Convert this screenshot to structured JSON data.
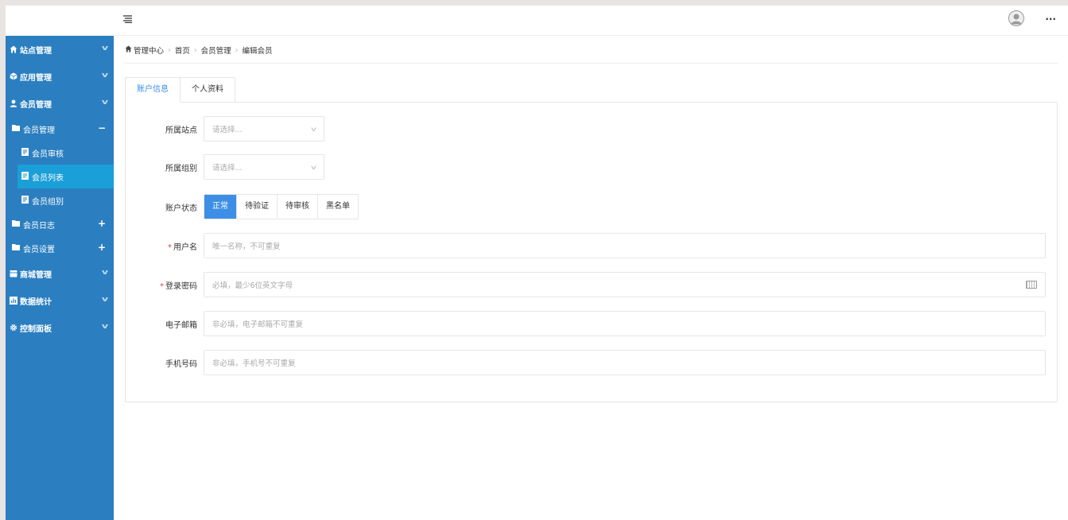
{
  "header": {
    "menu_icon": "hamburger-icon",
    "avatar_icon": "user-avatar-icon",
    "more_icon": "more-dots-icon",
    "more_label": "···"
  },
  "sidebar": {
    "items": [
      {
        "label": "站点管理",
        "icon": "home-icon"
      },
      {
        "label": "应用管理",
        "icon": "cube-icon"
      },
      {
        "label": "会员管理",
        "icon": "user-icon"
      }
    ],
    "member_group": {
      "label": "会员管理",
      "toggle": "−"
    },
    "member_leaves": [
      {
        "label": "会员审核"
      },
      {
        "label": "会员列表"
      },
      {
        "label": "会员组别"
      }
    ],
    "member_log": {
      "label": "会员日志",
      "toggle": "+"
    },
    "member_settings": {
      "label": "会员设置",
      "toggle": "+"
    },
    "bottom_items": [
      {
        "label": "商城管理",
        "icon": "shop-icon"
      },
      {
        "label": "数据统计",
        "icon": "chart-icon"
      },
      {
        "label": "控制面板",
        "icon": "gear-icon"
      }
    ]
  },
  "breadcrumb": [
    "管理中心",
    "首页",
    "会员管理",
    "编辑会员"
  ],
  "tabs": [
    "账户信息",
    "个人资料"
  ],
  "form": {
    "site": {
      "label": "所属站点",
      "placeholder": "请选择..."
    },
    "group": {
      "label": "所属组别",
      "placeholder": "请选择..."
    },
    "status": {
      "label": "账户状态",
      "options": [
        "正常",
        "待验证",
        "待审核",
        "黑名单"
      ],
      "selected": "正常"
    },
    "username": {
      "label": "用户名",
      "placeholder": "唯一名称，不可重复",
      "required": "*"
    },
    "password": {
      "label": "登录密码",
      "placeholder": "必填，最少6位英文字母",
      "required": "*"
    },
    "email": {
      "label": "电子邮箱",
      "placeholder": "非必填，电子邮箱不可重复"
    },
    "phone": {
      "label": "手机号码",
      "placeholder": "非必填，手机号不可重复"
    }
  },
  "colors": {
    "sidebar": "#2b7fc1",
    "active_item": "#1a9fd8",
    "primary": "#3d8fe5"
  }
}
